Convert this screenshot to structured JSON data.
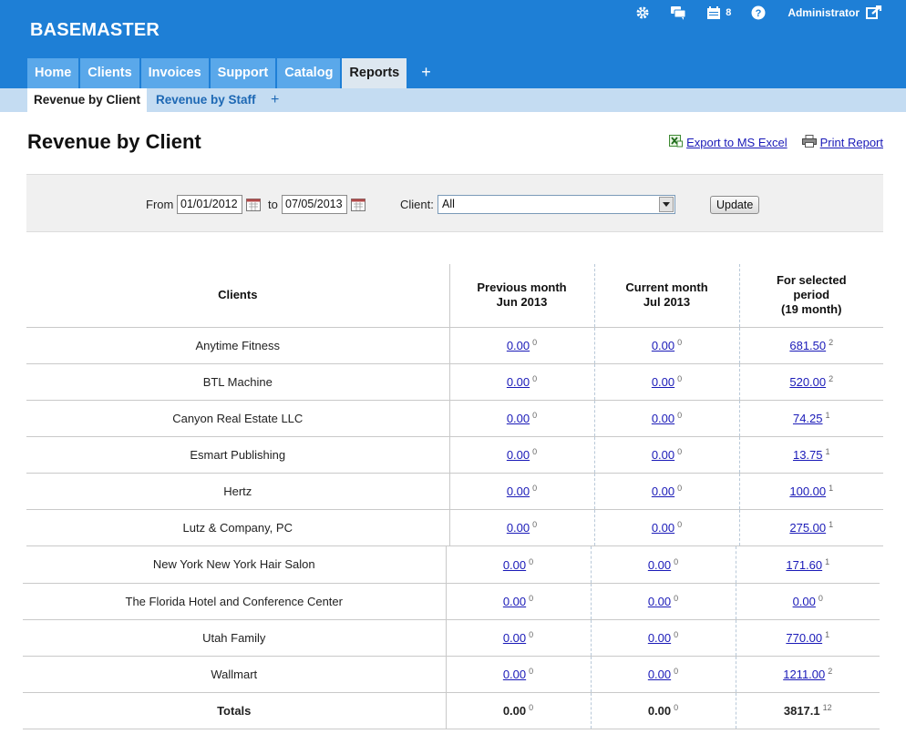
{
  "app": {
    "brand": "BASEMASTER",
    "notification_count": "8",
    "user": "Administrator"
  },
  "main_tabs": [
    {
      "label": "Home"
    },
    {
      "label": "Clients"
    },
    {
      "label": "Invoices"
    },
    {
      "label": "Support"
    },
    {
      "label": "Catalog"
    },
    {
      "label": "Reports"
    }
  ],
  "main_tabs_plus": "+",
  "sub_tabs": [
    {
      "label": "Revenue by Client"
    },
    {
      "label": "Revenue by Staff"
    }
  ],
  "sub_tabs_plus": "+",
  "page": {
    "title": "Revenue by Client",
    "export_label": "Export to MS Excel",
    "print_label": "Print Report"
  },
  "filter": {
    "from_label": "From",
    "from_value": "01/01/2012",
    "to_label": "to",
    "to_value": "07/05/2013",
    "client_label": "Client:",
    "client_value": "All",
    "update_label": "Update"
  },
  "table": {
    "headers": {
      "clients": "Clients",
      "prev_line1": "Previous month",
      "prev_line2": "Jun 2013",
      "curr_line1": "Current month",
      "curr_line2": "Jul 2013",
      "period_line1": "For selected",
      "period_line2": "period",
      "period_line3": "(19 month)"
    },
    "rows": [
      {
        "client": "Anytime Fitness",
        "prev": "0.00",
        "prev_count": "0",
        "curr": "0.00",
        "curr_count": "0",
        "period": "681.50",
        "period_count": "2"
      },
      {
        "client": "BTL Machine",
        "prev": "0.00",
        "prev_count": "0",
        "curr": "0.00",
        "curr_count": "0",
        "period": "520.00",
        "period_count": "2"
      },
      {
        "client": "Canyon Real Estate LLC",
        "prev": "0.00",
        "prev_count": "0",
        "curr": "0.00",
        "curr_count": "0",
        "period": "74.25",
        "period_count": "1"
      },
      {
        "client": "Esmart Publishing",
        "prev": "0.00",
        "prev_count": "0",
        "curr": "0.00",
        "curr_count": "0",
        "period": "13.75",
        "period_count": "1"
      },
      {
        "client": "Hertz",
        "prev": "0.00",
        "prev_count": "0",
        "curr": "0.00",
        "curr_count": "0",
        "period": "100.00",
        "period_count": "1"
      },
      {
        "client": "Lutz & Company, PC",
        "prev": "0.00",
        "prev_count": "0",
        "curr": "0.00",
        "curr_count": "0",
        "period": "275.00",
        "period_count": "1"
      },
      {
        "client": "New York New York Hair Salon",
        "prev": "0.00",
        "prev_count": "0",
        "curr": "0.00",
        "curr_count": "0",
        "period": "171.60",
        "period_count": "1"
      },
      {
        "client": "The Florida Hotel and Conference Center",
        "prev": "0.00",
        "prev_count": "0",
        "curr": "0.00",
        "curr_count": "0",
        "period": "0.00",
        "period_count": "0"
      },
      {
        "client": "Utah Family",
        "prev": "0.00",
        "prev_count": "0",
        "curr": "0.00",
        "curr_count": "0",
        "period": "770.00",
        "period_count": "1"
      },
      {
        "client": "Wallmart",
        "prev": "0.00",
        "prev_count": "0",
        "curr": "0.00",
        "curr_count": "0",
        "period": "1211.00",
        "period_count": "2"
      }
    ],
    "totals": {
      "label": "Totals",
      "prev": "0.00",
      "prev_count": "0",
      "curr": "0.00",
      "curr_count": "0",
      "period": "3817.1",
      "period_count": "12"
    }
  },
  "colors": {
    "header_bg": "#1e7fd6",
    "tab_bg": "#5aa8ea",
    "active_tab_bg": "#dde7f0",
    "subnav_bg": "#c4dcf2",
    "link": "#1a1ab8"
  },
  "icons": [
    "gear-icon",
    "chat-icon",
    "calendar-icon",
    "help-icon",
    "logout-icon",
    "excel-icon",
    "printer-icon",
    "date-picker-icon",
    "dropdown-arrow-icon"
  ]
}
